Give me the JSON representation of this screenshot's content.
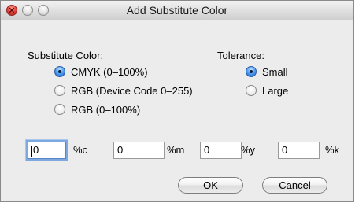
{
  "window": {
    "title": "Add Substitute Color"
  },
  "substitute_color": {
    "label": "Substitute Color:",
    "options": [
      {
        "label": "CMYK (0–100%)",
        "selected": true
      },
      {
        "label": "RGB (Device Code 0–255)",
        "selected": false
      },
      {
        "label": "RGB (0–100%)",
        "selected": false
      }
    ]
  },
  "tolerance": {
    "label": "Tolerance:",
    "options": [
      {
        "label": "Small",
        "selected": true
      },
      {
        "label": "Large",
        "selected": false
      }
    ]
  },
  "fields": [
    {
      "value": "0",
      "unit": "%c",
      "focused": true
    },
    {
      "value": "0",
      "unit": "%m",
      "focused": false
    },
    {
      "value": "0",
      "unit": "%y",
      "focused": false
    },
    {
      "value": "0",
      "unit": "%k",
      "focused": false
    }
  ],
  "buttons": {
    "ok_label": "OK",
    "cancel_label": "Cancel"
  }
}
